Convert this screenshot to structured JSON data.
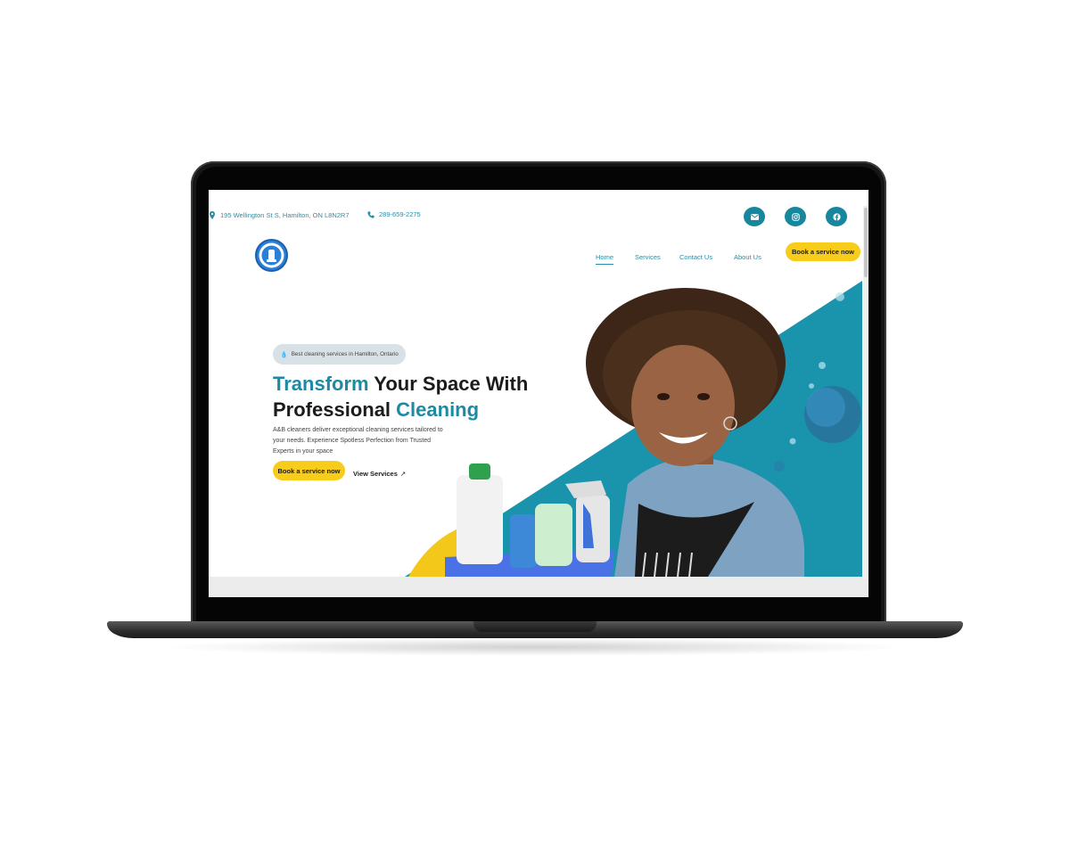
{
  "topbar": {
    "address": "195 Wellington St S, Hamilton, ON L8N2R7",
    "phone": "289-659-2275",
    "social_icons": [
      "mail-icon",
      "instagram-icon",
      "facebook-icon"
    ]
  },
  "nav": {
    "items": [
      {
        "label": "Home",
        "active": true
      },
      {
        "label": "Services",
        "active": false
      },
      {
        "label": "Contact Us",
        "active": false
      },
      {
        "label": "About Us",
        "active": false
      }
    ],
    "cta_label": "Book a service now"
  },
  "hero": {
    "badge": "Best cleaning services in Hamilton, Ontario",
    "heading": {
      "part1": "Transform",
      "part2": " Your Space With",
      "part3": "Professional ",
      "part4": "Cleaning"
    },
    "description": "A&B cleaners deliver exceptional cleaning services tailored to your needs. Experience Spotless Perfection from Trusted Experts in your space",
    "primary_cta": "Book a service now",
    "secondary_cta": "View Services",
    "secondary_cta_icon": "↗"
  },
  "colors": {
    "accent": "#1d8aa3",
    "cta": "#f8cc1b",
    "social_bg": "#17879d"
  }
}
